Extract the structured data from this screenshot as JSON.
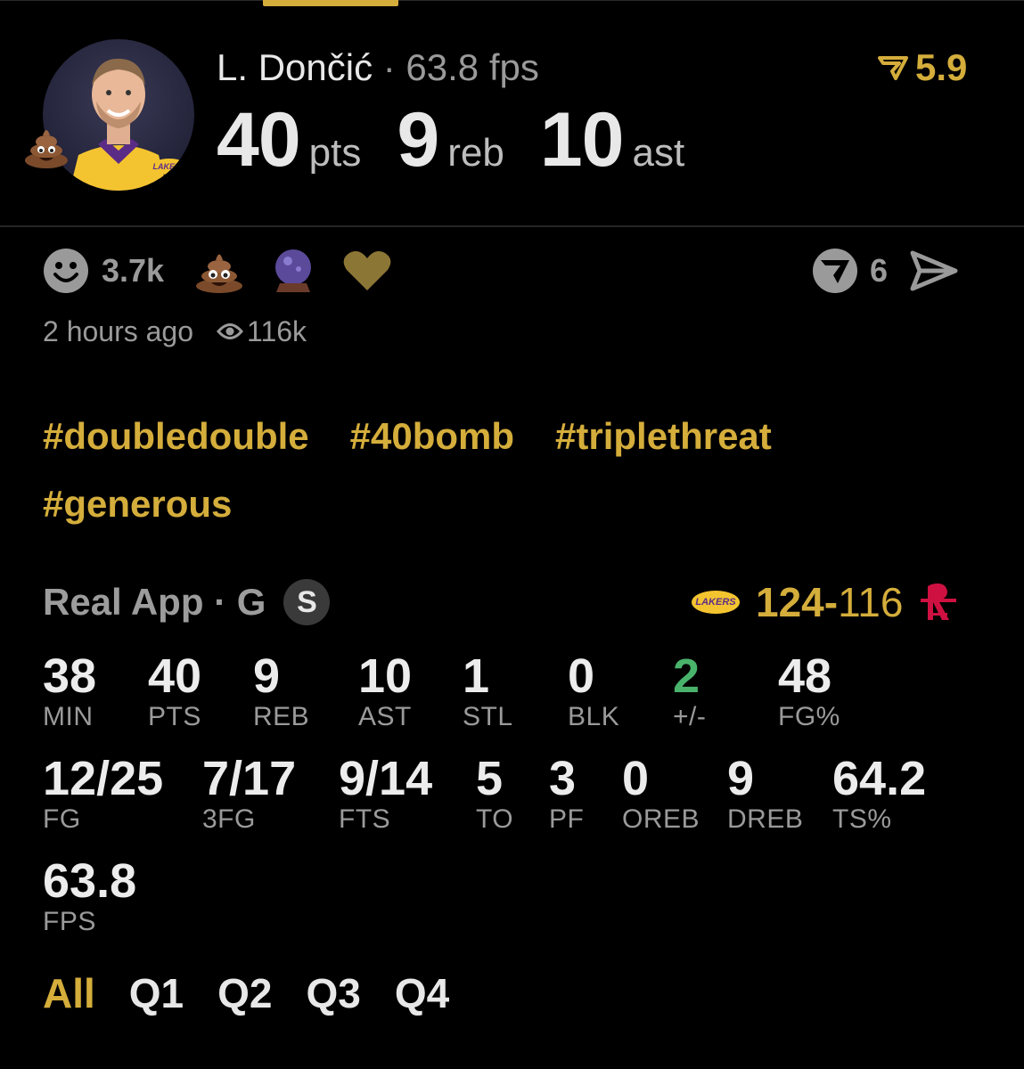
{
  "header": {
    "player_name": "L. Dončić",
    "separator": " · ",
    "fps": "63.8 fps",
    "rating": "5.9",
    "line": [
      {
        "value": "40",
        "unit": "pts"
      },
      {
        "value": "9",
        "unit": "reb"
      },
      {
        "value": "10",
        "unit": "ast"
      }
    ],
    "avatar_team_logo": "LAKERS"
  },
  "reactions": {
    "count": "3.7k",
    "icons": [
      "smiley-icon",
      "poop-emoji-icon",
      "crystal-ball-icon",
      "heart-icon"
    ],
    "predictions_count": "6",
    "time_ago": "2 hours ago",
    "views": "116k"
  },
  "tags": [
    "#doubledouble",
    "#40bomb",
    "#triplethreat",
    "#generous"
  ],
  "game": {
    "source": "Real App",
    "position": "G",
    "badge": "S",
    "home_logo": "LAKERS",
    "home_score": "124",
    "dash": "-",
    "away_score": "116"
  },
  "stats": [
    {
      "value": "38",
      "label": "MIN"
    },
    {
      "value": "40",
      "label": "PTS"
    },
    {
      "value": "9",
      "label": "REB"
    },
    {
      "value": "10",
      "label": "AST"
    },
    {
      "value": "1",
      "label": "STL"
    },
    {
      "value": "0",
      "label": "BLK"
    },
    {
      "value": "2",
      "label": "+/-"
    },
    {
      "value": "48",
      "label": "FG%"
    },
    {
      "value": "12/25",
      "label": "FG"
    },
    {
      "value": "7/17",
      "label": "3FG"
    },
    {
      "value": "9/14",
      "label": "FTS"
    },
    {
      "value": "5",
      "label": "TO"
    },
    {
      "value": "3",
      "label": "PF"
    },
    {
      "value": "0",
      "label": "OREB"
    },
    {
      "value": "9",
      "label": "DREB"
    },
    {
      "value": "64.2",
      "label": "TS%"
    },
    {
      "value": "63.8",
      "label": "FPS"
    }
  ],
  "colors": {
    "accent": "#d4ad3b",
    "positive": "#49b36c",
    "rockets_red": "#ce1141"
  },
  "quarter_tabs": [
    "All",
    "Q1",
    "Q2",
    "Q3",
    "Q4"
  ]
}
